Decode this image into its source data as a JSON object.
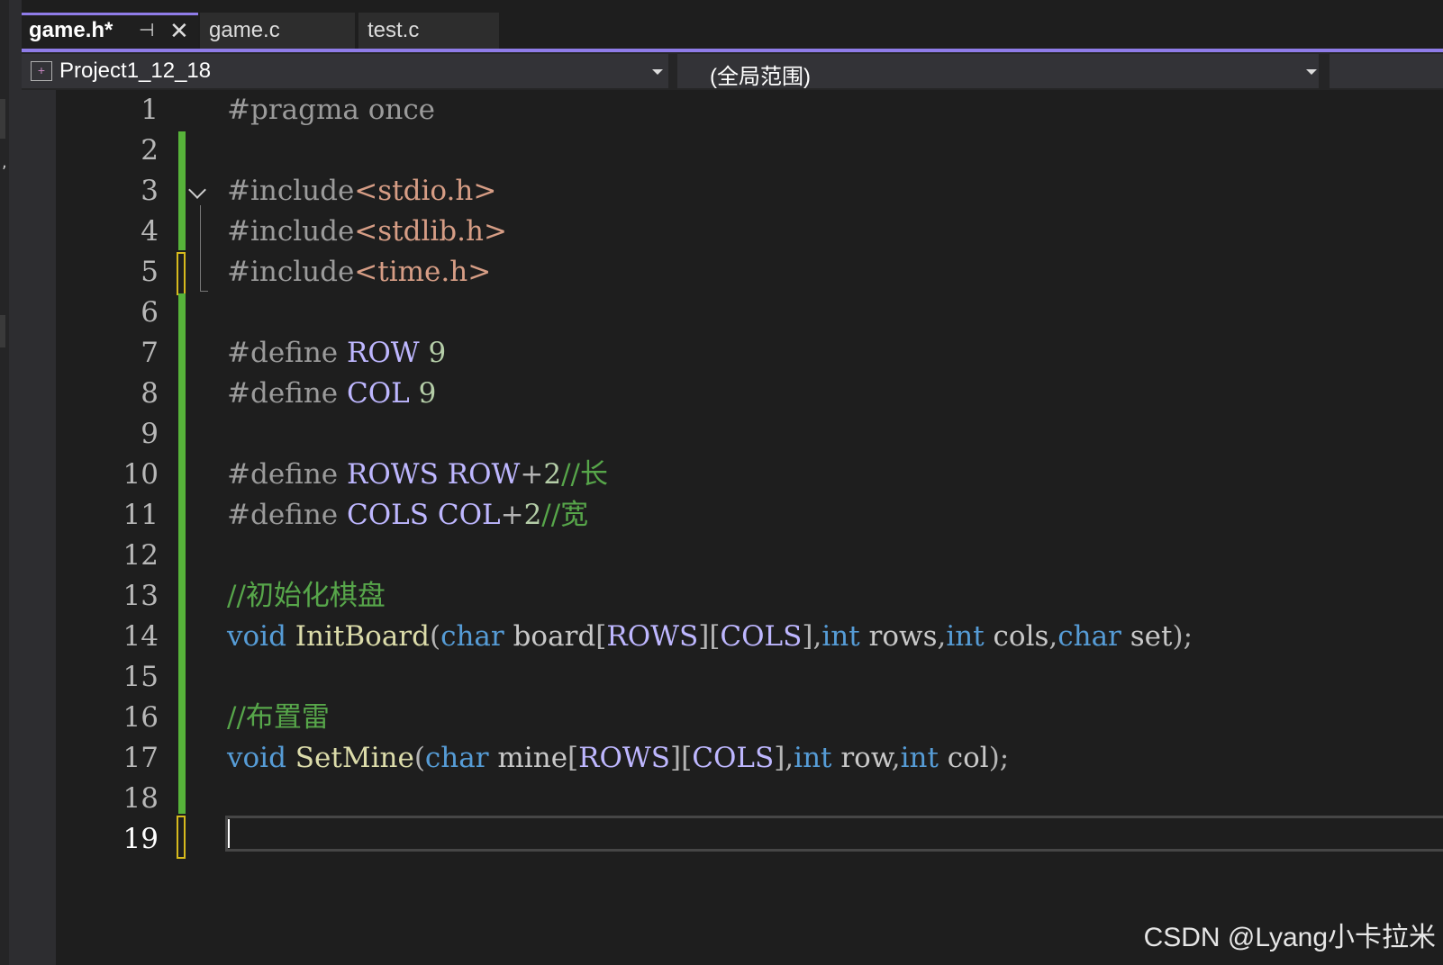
{
  "tabs": [
    {
      "label": "game.h*",
      "active": true,
      "pin_icon": "pin-icon",
      "close_icon": "close-icon"
    },
    {
      "label": "game.c",
      "active": false
    },
    {
      "label": "test.c",
      "active": false
    }
  ],
  "nav": {
    "project": "Project1_12_18",
    "scope": "(全局范围)"
  },
  "colors": {
    "accent": "#8f7ce8",
    "change_saved": "#57b33a",
    "change_unsaved": "#d7ba1d",
    "keyword": "#569cd6",
    "macro": "#beb7ff",
    "include_path": "#d69d85",
    "comment": "#57a64a",
    "number": "#b5cea8",
    "function": "#dcdcaa"
  },
  "line_numbers": [
    "1",
    "2",
    "3",
    "4",
    "5",
    "6",
    "7",
    "8",
    "9",
    "10",
    "11",
    "12",
    "13",
    "14",
    "15",
    "16",
    "17",
    "18",
    "19"
  ],
  "current_line": "19",
  "code": {
    "l1": {
      "pp": "#pragma once"
    },
    "l3": {
      "pp": "#include",
      "inc": "<stdio.h>"
    },
    "l4": {
      "pp": "#include",
      "inc": "<stdlib.h>"
    },
    "l5": {
      "pp": "#include",
      "inc": "<time.h>"
    },
    "l7": {
      "pp": "#define ",
      "name": "ROW",
      "sp": " ",
      "val": "9"
    },
    "l8": {
      "pp": "#define ",
      "name": "COL",
      "sp": " ",
      "val": "9"
    },
    "l10": {
      "pp": "#define ",
      "name": "ROWS",
      "sp": " ",
      "ref": "ROW",
      "op": "+",
      "val": "2",
      "cmt": "//长"
    },
    "l11": {
      "pp": "#define ",
      "name": "COLS",
      "sp": " ",
      "ref": "COL",
      "op": "+",
      "val": "2",
      "cmt": "//宽"
    },
    "l13": {
      "cmt": "//初始化棋盘"
    },
    "l14": {
      "kw_void": "void",
      "sp1": " ",
      "fn": "InitBoard",
      "p_open": "(",
      "kw_char1": "char",
      "board": " board",
      "b1": "[",
      "m_rows": "ROWS",
      "b2": "][",
      "m_cols": "COLS",
      "b3": "]",
      "c1": ",",
      "kw_int1": "int",
      "rows": " rows",
      "c2": ",",
      "kw_int2": "int",
      "cols": " cols",
      "c3": ",",
      "kw_char2": "char",
      "set": " set",
      "end": ");"
    },
    "l16": {
      "cmt": "//布置雷"
    },
    "l17": {
      "kw_void": "void",
      "sp1": " ",
      "fn": "SetMine",
      "p_open": "(",
      "kw_char1": "char",
      "mine": " mine",
      "b1": "[",
      "m_rows": "ROWS",
      "b2": "][",
      "m_cols": "COLS",
      "b3": "]",
      "c1": ",",
      "kw_int1": "int",
      "row": " row",
      "c2": ",",
      "kw_int2": "int",
      "col": " col",
      "end": ");"
    }
  },
  "watermark": "CSDN @Lyang小卡拉米"
}
